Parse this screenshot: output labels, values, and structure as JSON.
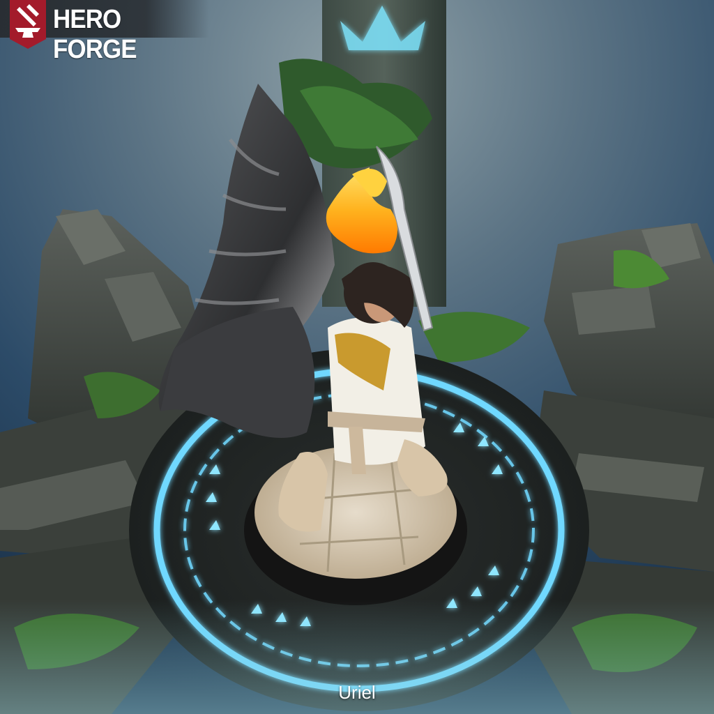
{
  "app": {
    "brand_name": "HERO FORGE",
    "logo_icon": "anvil-hammer-icon"
  },
  "miniature": {
    "name": "Uriel"
  },
  "colors": {
    "brand_red": "#a31b2b",
    "rune_glow": "#6fd8ff",
    "stone": "#4a5049",
    "wing": "#3a3b3d",
    "robe": "#f2efe6",
    "gold_trim": "#c99a2e",
    "flame": "#ffb21e",
    "base_top": "#d8cbb5"
  }
}
